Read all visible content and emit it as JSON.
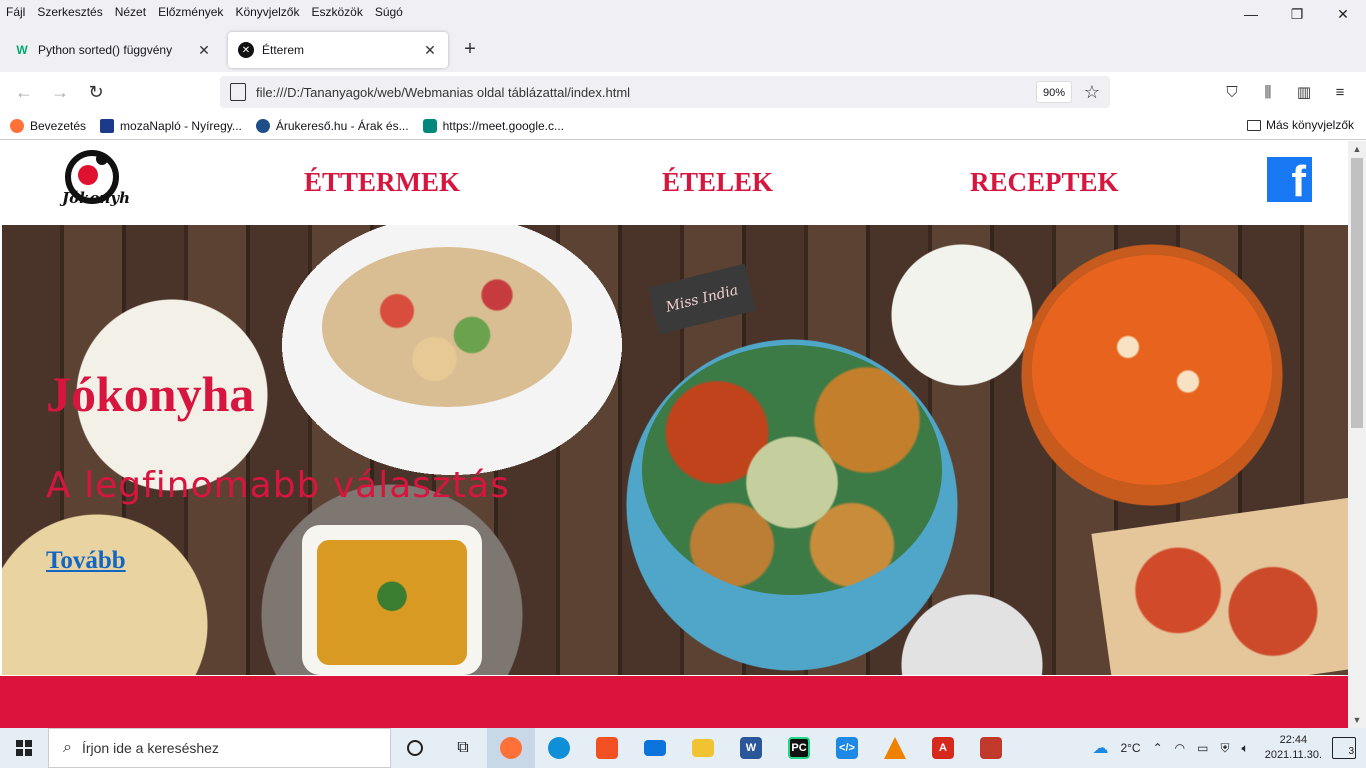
{
  "menubar": {
    "items": [
      "Fájl",
      "Szerkesztés",
      "Nézet",
      "Előzmények",
      "Könyvjelzők",
      "Eszközök",
      "Súgó"
    ]
  },
  "tabs": [
    {
      "title": "Python sorted() függvény",
      "favicon": "W"
    },
    {
      "title": "Étterem",
      "favicon": "✕"
    }
  ],
  "navbar": {
    "url": "file:///D:/Tananyagok/web/Webmanias oldal táblázattal/index.html",
    "zoom": "90%"
  },
  "bookmarks": [
    {
      "label": "Bevezetés",
      "color": "#ff7139"
    },
    {
      "label": "mozaNapló - Nyíregy...",
      "color": "#1b3a8c"
    },
    {
      "label": "Árukereső.hu - Árak és...",
      "color": "#1e4f8a"
    },
    {
      "label": "https://meet.google.c...",
      "color": "#00897b"
    }
  ],
  "bookmarks_folder": "Más könyvjelzők",
  "site": {
    "logo_text": "Jókonyha!",
    "nav": [
      "ÉTTERMEK",
      "ÉTELEK",
      "RECEPTEK"
    ],
    "hero_title": "Jókonyha",
    "hero_subtitle": "A legfinomabb választás",
    "hero_link": "Tovább",
    "hero_image_text": "Miss India",
    "accent": "#d6163e"
  },
  "taskbar": {
    "search_placeholder": "Írjon ide a kereséshez",
    "weather": "2°C",
    "time": "22:44",
    "date": "2021.11.30.",
    "notifications": "3"
  }
}
